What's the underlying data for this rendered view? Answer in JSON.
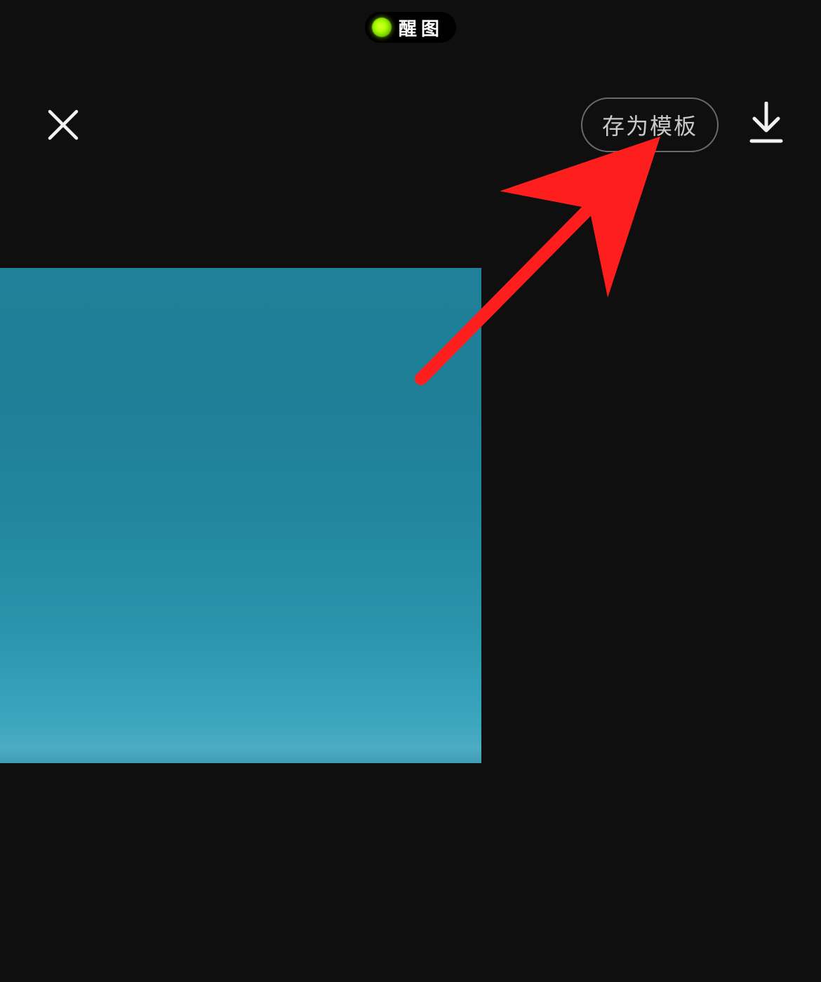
{
  "brand": {
    "name": "醒图",
    "dot_color": "#aaff00"
  },
  "toolbar": {
    "save_as_template_label": "存为模板",
    "icons": {
      "close": "close-icon",
      "download": "download-icon"
    }
  },
  "annotation": {
    "arrow_color": "#ff1e1e"
  }
}
